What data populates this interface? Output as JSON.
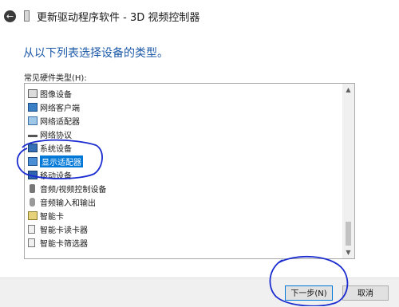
{
  "window": {
    "title": "更新驱动程序软件 - 3D 视频控制器",
    "back_icon": "back-arrow-icon",
    "app_icon": "device-icon"
  },
  "main": {
    "heading": "从以下列表选择设备的类型。",
    "list_label": "常见硬件类型(H):",
    "items": [
      {
        "label": "图像设备",
        "icon": "imaging-device-icon"
      },
      {
        "label": "网络客户端",
        "icon": "network-client-icon"
      },
      {
        "label": "网络适配器",
        "icon": "network-adapter-icon"
      },
      {
        "label": "网络协议",
        "icon": "network-protocol-icon"
      },
      {
        "label": "系统设备",
        "icon": "system-device-icon"
      },
      {
        "label": "显示适配器",
        "icon": "display-adapter-icon",
        "selected": true
      },
      {
        "label": "移动设备",
        "icon": "mobile-device-icon"
      },
      {
        "label": "音频/视频控制设备",
        "icon": "audio-video-icon"
      },
      {
        "label": "音频输入和输出",
        "icon": "microphone-icon"
      },
      {
        "label": "智能卡",
        "icon": "smart-card-icon"
      },
      {
        "label": "智能卡读卡器",
        "icon": "card-reader-icon"
      },
      {
        "label": "智能卡筛选器",
        "icon": "card-filter-icon"
      }
    ]
  },
  "footer": {
    "next_label": "下一步(N)",
    "cancel_label": "取消"
  },
  "colors": {
    "heading": "#1c5aa9",
    "selection": "#0078d7",
    "annotation": "#1a2bd0"
  }
}
